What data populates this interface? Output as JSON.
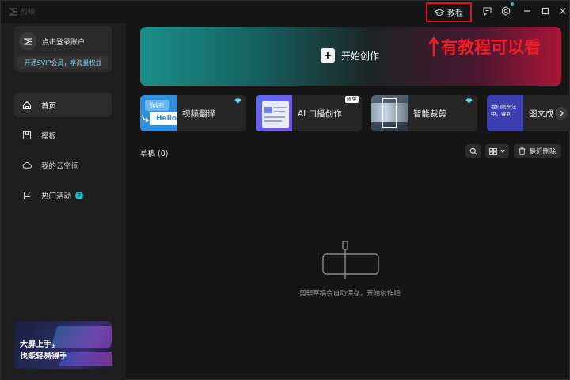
{
  "titlebar": {
    "app_name": "剪映",
    "tutorial_label": "教程",
    "icons": [
      "feedback-icon",
      "settings-icon",
      "minimize-icon",
      "maximize-icon",
      "close-icon"
    ],
    "notify_color": "#18c6d3",
    "highlight_color": "#e0141e"
  },
  "sidebar": {
    "login_text": "点击登录账户",
    "svip_text": "开通SVIP会员，享海量权益",
    "nav": [
      {
        "label": "首页",
        "icon": "home-icon",
        "active": true
      },
      {
        "label": "模板",
        "icon": "template-icon",
        "active": false
      },
      {
        "label": "我的云空间",
        "icon": "cloud-icon",
        "active": false
      },
      {
        "label": "热门活动",
        "icon": "flag-icon",
        "active": false,
        "badge": "7"
      }
    ],
    "promo_line1": "大屏上手，",
    "promo_line2": "也能轻易得手"
  },
  "hero": {
    "start_label": "开始创作"
  },
  "annotation": {
    "text": "有教程可以看",
    "color": "#f21e2a"
  },
  "tools": [
    {
      "label": "视频翻译",
      "thumb_text_top": "你好!",
      "thumb_text_bottom": "Hello",
      "badge": "diamond"
    },
    {
      "label": "AI 口播创作",
      "badge": "限免"
    },
    {
      "label": "智能裁剪",
      "badge": "diamond"
    },
    {
      "label": "图文成",
      "thumb_text": "我们熊车法中。睿到",
      "badge": "diamond"
    }
  ],
  "drafts": {
    "title": "草稿  (0)",
    "recent_delete": "最近删除",
    "empty_text": "剪辑草稿会自动保存，开始创作吧"
  },
  "colors": {
    "accent": "#18bfd0",
    "background": "#151515",
    "sidebar": "#1e1e1e"
  }
}
